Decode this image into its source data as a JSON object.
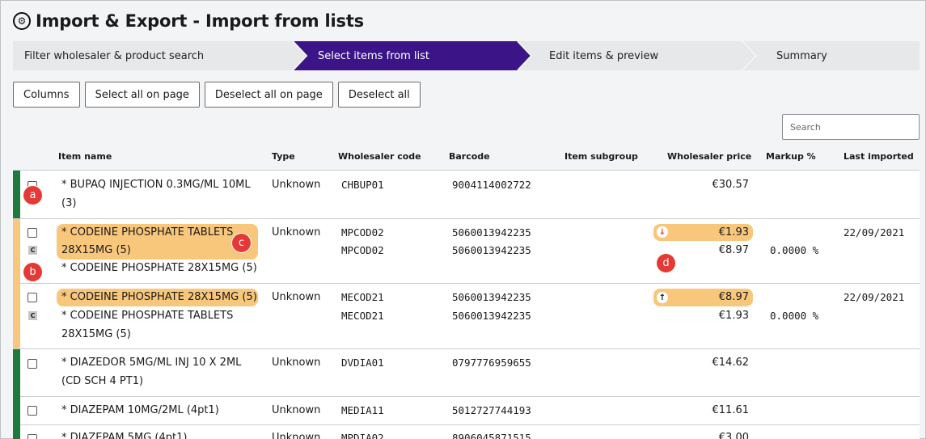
{
  "title": "Import & Export - Import from lists",
  "steps": [
    "Filter wholesaler & product search",
    "Select items from list",
    "Edit items & preview",
    "Summary"
  ],
  "buttons": {
    "columns": "Columns",
    "select_all": "Select all on page",
    "deselect_page": "Deselect all on page",
    "deselect_all": "Deselect all"
  },
  "search": {
    "placeholder": "Search"
  },
  "headers": {
    "item_name": "Item name",
    "type": "Type",
    "wholesaler_code": "Wholesaler code",
    "barcode": "Barcode",
    "item_subgroup": "Item subgroup",
    "wholesaler_price": "Wholesaler price",
    "markup": "Markup %",
    "last_imported": "Last imported"
  },
  "rows": [
    {
      "name_l1": "* BUPAQ INJECTION 0.3MG/ML 10ML",
      "name_l2": "(3)",
      "type": "Unknown",
      "code": "CHBUP01",
      "barcode": "9004114002722",
      "price": "€30.57"
    },
    {
      "name_l1": "* CODEINE PHOSPHATE TABLETS",
      "name_l2": "28X15MG (5)",
      "name_l3": "* CODEINE PHOSPHATE 28X15MG (5)",
      "type": "Unknown",
      "code": "MPCOD02",
      "code2": "MPCOD02",
      "barcode": "5060013942235",
      "barcode2": "5060013942235",
      "price": "€1.93",
      "price2": "€8.97",
      "markup": "0.0000 %",
      "last": "22/09/2021",
      "badge": "C",
      "arrow": "↓"
    },
    {
      "name_l1": "* CODEINE PHOSPHATE 28X15MG (5)",
      "name_l2": "* CODEINE PHOSPHATE TABLETS",
      "name_l3": "28X15MG (5)",
      "type": "Unknown",
      "code": "MECOD21",
      "code2": "MECOD21",
      "barcode": "5060013942235",
      "barcode2": "5060013942235",
      "price": "€8.97",
      "price2": "€1.93",
      "markup": "0.0000 %",
      "last": "22/09/2021",
      "badge": "C",
      "arrow": "↑"
    },
    {
      "name_l1": "* DIAZEDOR 5MG/ML INJ 10 X 2ML",
      "name_l2": "(CD SCH 4 PT1)",
      "type": "Unknown",
      "code": "DVDIA01",
      "barcode": "0797776959655",
      "price": "€14.62"
    },
    {
      "name_l1": "* DIAZEPAM 10MG/2ML (4pt1)",
      "type": "Unknown",
      "code": "MEDIA11",
      "barcode": "5012727744193",
      "price": "€11.61"
    },
    {
      "name_l1": "* DIAZEPAM 5MG (4pt1)",
      "type": "Unknown",
      "code": "MPDIA02",
      "barcode": "8906045871515",
      "price": "€3.00"
    }
  ],
  "markers": [
    "a",
    "b",
    "c",
    "d"
  ],
  "colors": {
    "accent": "#3b1587",
    "green": "#1e7a3c",
    "orange": "#f8c77c",
    "marker": "#e53935"
  }
}
